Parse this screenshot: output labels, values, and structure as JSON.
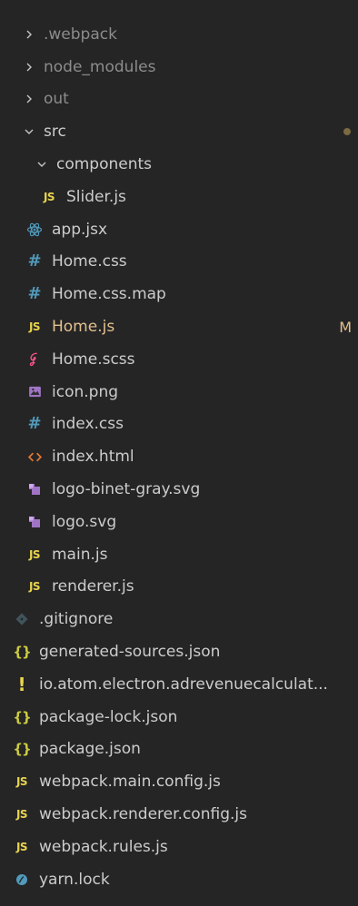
{
  "explorer": {
    "items": [
      {
        "label": ".webpack",
        "type": "folder",
        "expanded": false,
        "depth": 0,
        "dim": true
      },
      {
        "label": "node_modules",
        "type": "folder",
        "expanded": false,
        "depth": 0,
        "dim": true
      },
      {
        "label": "out",
        "type": "folder",
        "expanded": false,
        "depth": 0,
        "dim": true
      },
      {
        "label": "src",
        "type": "folder",
        "expanded": true,
        "depth": 0,
        "decoration": "modified-dot"
      },
      {
        "label": "components",
        "type": "folder",
        "expanded": true,
        "depth": 1
      },
      {
        "label": "Slider.js",
        "type": "file",
        "icon": "js-icon",
        "depth": 2
      },
      {
        "label": "app.jsx",
        "type": "file",
        "icon": "react-icon",
        "depth": 1
      },
      {
        "label": "Home.css",
        "type": "file",
        "icon": "css-icon",
        "depth": 1
      },
      {
        "label": "Home.css.map",
        "type": "file",
        "icon": "css-icon",
        "depth": 1
      },
      {
        "label": "Home.js",
        "type": "file",
        "icon": "js-icon",
        "depth": 1,
        "status": "M"
      },
      {
        "label": "Home.scss",
        "type": "file",
        "icon": "sass-icon",
        "depth": 1
      },
      {
        "label": "icon.png",
        "type": "file",
        "icon": "image-icon",
        "depth": 1
      },
      {
        "label": "index.css",
        "type": "file",
        "icon": "css-icon",
        "depth": 1
      },
      {
        "label": "index.html",
        "type": "file",
        "icon": "html-icon",
        "depth": 1
      },
      {
        "label": "logo-binet-gray.svg",
        "type": "file",
        "icon": "svg-icon",
        "depth": 1
      },
      {
        "label": "logo.svg",
        "type": "file",
        "icon": "svg-icon",
        "depth": 1
      },
      {
        "label": "main.js",
        "type": "file",
        "icon": "js-icon",
        "depth": 1
      },
      {
        "label": "renderer.js",
        "type": "file",
        "icon": "js-icon",
        "depth": 1
      },
      {
        "label": ".gitignore",
        "type": "file",
        "icon": "git-icon",
        "depth": 0
      },
      {
        "label": "generated-sources.json",
        "type": "file",
        "icon": "json-icon",
        "depth": 0
      },
      {
        "label": "io.atom.electron.adrevenuecalculat...",
        "type": "file",
        "icon": "exclamation-icon",
        "depth": 0
      },
      {
        "label": "package-lock.json",
        "type": "file",
        "icon": "json-icon",
        "depth": 0
      },
      {
        "label": "package.json",
        "type": "file",
        "icon": "json-icon",
        "depth": 0
      },
      {
        "label": "webpack.main.config.js",
        "type": "file",
        "icon": "js-icon",
        "depth": 0
      },
      {
        "label": "webpack.renderer.config.js",
        "type": "file",
        "icon": "js-icon",
        "depth": 0
      },
      {
        "label": "webpack.rules.js",
        "type": "file",
        "icon": "js-icon",
        "depth": 0
      },
      {
        "label": "yarn.lock",
        "type": "file",
        "icon": "yarn-icon",
        "depth": 0
      }
    ]
  },
  "icons": {
    "js_text": "JS",
    "css_text": "#",
    "json_text": "{}",
    "bang_text": "!"
  },
  "colors": {
    "background": "#252526",
    "text": "#cccccc",
    "dim_text": "#8c8c8c",
    "modified": "#e2c08d",
    "js": "#e8d44d",
    "css": "#519aba",
    "json": "#cbcb41",
    "sass": "#f55385",
    "html": "#e37933",
    "react": "#519aba",
    "svg": "#a074c4",
    "git": "#41535b",
    "yarn": "#519aba"
  }
}
